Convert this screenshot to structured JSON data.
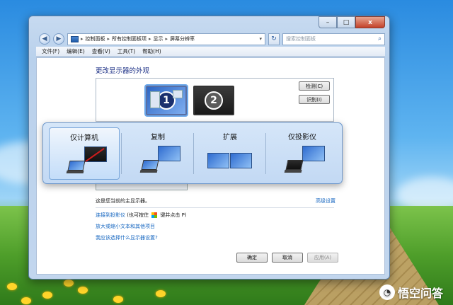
{
  "window": {
    "caption": {
      "minimize": "–",
      "maximize": "□",
      "close": "x"
    },
    "nav": {
      "back": "◀",
      "forward": "▶"
    },
    "address": {
      "crumbs": [
        "控制面板",
        "所有控制面板项",
        "显示",
        "屏幕分辨率"
      ],
      "separator": "▸",
      "dropdown": "▾"
    },
    "refresh": "↻",
    "search": {
      "placeholder": "搜索控制面板",
      "icon": "⌕"
    },
    "menu": [
      "文件(F)",
      "编辑(E)",
      "查看(V)",
      "工具(T)",
      "帮助(H)"
    ]
  },
  "content": {
    "heading": "更改显示器的外观",
    "monitors": [
      {
        "number": "1"
      },
      {
        "number": "2"
      }
    ],
    "detect_button": "检测(C)",
    "identify_button": "识别(I)",
    "primary_text": "这是您当前的主显示器。",
    "advanced_link": "高级设置",
    "links": {
      "projector_link": "连接到投影仪",
      "projector_hint_prefix": "(也可按住",
      "projector_hint_suffix": "键并点击 P)",
      "text_size_link": "放大或缩小文本和其他项目",
      "which_settings_link": "我应该选择什么显示器设置?"
    },
    "buttons": {
      "ok": "确定",
      "cancel": "取消",
      "apply": "应用(A)"
    }
  },
  "overlay": {
    "options": [
      {
        "label": "仅计算机",
        "selected": true
      },
      {
        "label": "复制",
        "selected": false
      },
      {
        "label": "扩展",
        "selected": false
      },
      {
        "label": "仅投影仪",
        "selected": false
      }
    ]
  },
  "watermark": {
    "logo": "◔",
    "text": "悟空问答"
  }
}
